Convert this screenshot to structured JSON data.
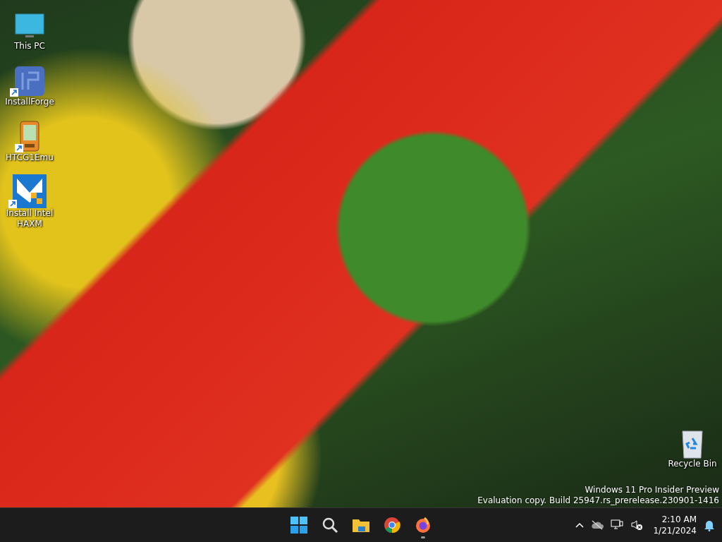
{
  "desktop_icons": [
    {
      "label": "This PC",
      "kind": "pc",
      "shortcut": false
    },
    {
      "label": "InstallForge",
      "kind": "installer",
      "shortcut": true
    },
    {
      "label": "HTCG1Emu",
      "kind": "handheld",
      "shortcut": true
    },
    {
      "label": "Install Intel HAXM",
      "kind": "haxm",
      "shortcut": true
    }
  ],
  "recycle_bin": {
    "label": "Recycle Bin"
  },
  "watermark": {
    "edition": "Windows 11 Pro Insider Preview",
    "build": "Evaluation copy. Build 25947.rs_prerelease.230901-1416"
  },
  "taskbar": {
    "apps": [
      {
        "kind": "start",
        "running": false
      },
      {
        "kind": "search",
        "running": false
      },
      {
        "kind": "folder",
        "running": false
      },
      {
        "kind": "chrome",
        "running": false
      },
      {
        "kind": "firefox",
        "running": true
      }
    ],
    "tray": [
      {
        "kind": "chevron"
      },
      {
        "kind": "cloud-off"
      },
      {
        "kind": "network"
      },
      {
        "kind": "muted"
      }
    ],
    "clock": {
      "time": "2:10 AM",
      "date": "1/21/2024"
    }
  }
}
